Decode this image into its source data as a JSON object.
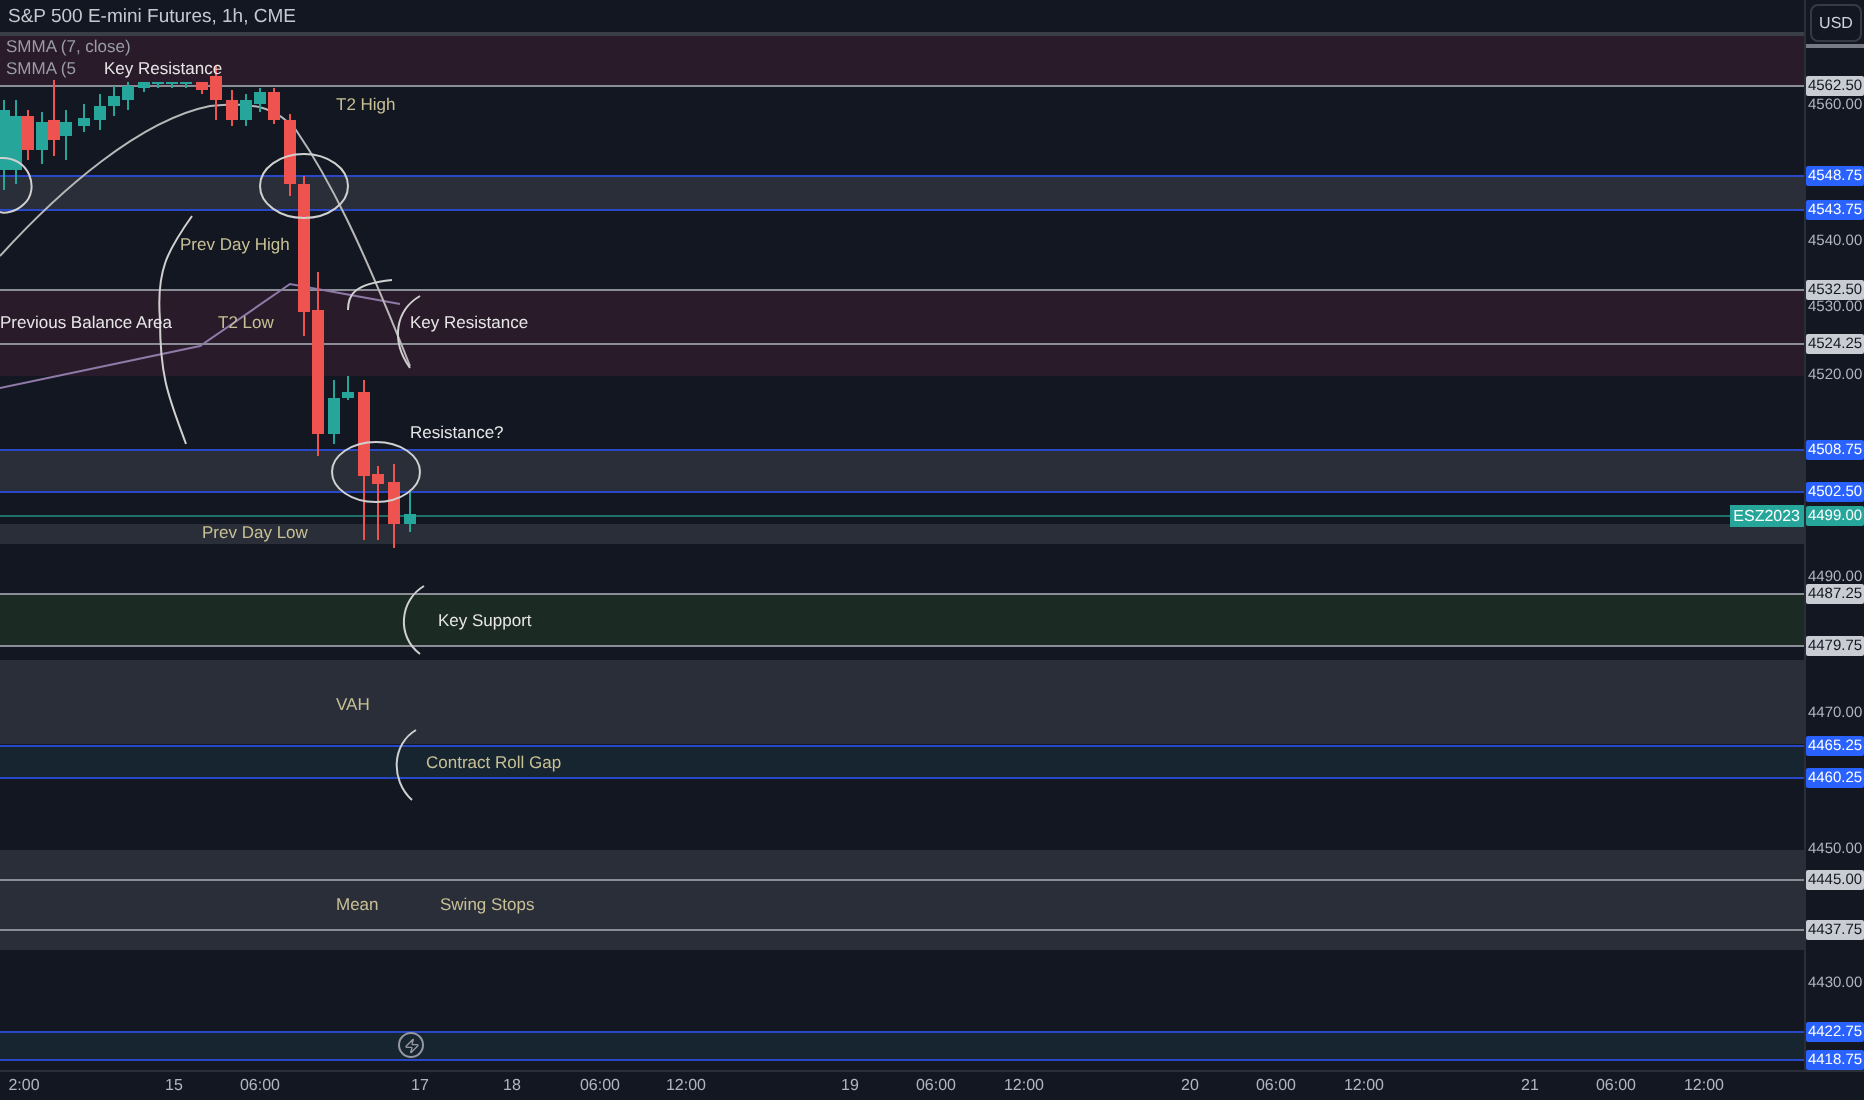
{
  "header": {
    "title": "S&P 500 E-mini Futures, 1h, CME",
    "indicators": [
      "SMMA (7, close)",
      "SMMA (5"
    ]
  },
  "currency_button": "USD",
  "annotations": [
    {
      "text": "Key Resistance",
      "kind": "note"
    },
    {
      "text": "T2 High",
      "kind": "level"
    },
    {
      "text": "Prev Day High",
      "kind": "level"
    },
    {
      "text": "Previous Balance Area",
      "kind": "note"
    },
    {
      "text": "T2 Low",
      "kind": "level"
    },
    {
      "text": "Key Resistance",
      "kind": "note"
    },
    {
      "text": "Resistance?",
      "kind": "note"
    },
    {
      "text": "Prev Day Low",
      "kind": "level"
    },
    {
      "text": "Key Support",
      "kind": "note"
    },
    {
      "text": "VAH",
      "kind": "level"
    },
    {
      "text": "Contract Roll Gap",
      "kind": "level"
    },
    {
      "text": "Mean",
      "kind": "level"
    },
    {
      "text": "Swing Stops",
      "kind": "level"
    }
  ],
  "price_ticks": [
    "4560.00",
    "4540.00",
    "4530.00",
    "4520.00",
    "4490.00",
    "4470.00",
    "4450.00",
    "4430.00"
  ],
  "price_tags": [
    {
      "text": "4562.50",
      "kind": "grey"
    },
    {
      "text": "4548.75",
      "kind": "blue"
    },
    {
      "text": "4543.75",
      "kind": "blue"
    },
    {
      "text": "4532.50",
      "kind": "grey"
    },
    {
      "text": "4524.25",
      "kind": "grey"
    },
    {
      "text": "4508.75",
      "kind": "blue"
    },
    {
      "text": "4502.50",
      "kind": "blue"
    },
    {
      "text": "4499.00",
      "kind": "last",
      "symbol": "ESZ2023"
    },
    {
      "text": "4487.25",
      "kind": "grey"
    },
    {
      "text": "4479.75",
      "kind": "grey"
    },
    {
      "text": "4465.25",
      "kind": "blue"
    },
    {
      "text": "4460.25",
      "kind": "blue"
    },
    {
      "text": "4445.00",
      "kind": "grey"
    },
    {
      "text": "4437.75",
      "kind": "grey"
    },
    {
      "text": "4422.75",
      "kind": "blue"
    },
    {
      "text": "4418.75",
      "kind": "blue"
    }
  ],
  "time_ticks": [
    "2:00",
    "15",
    "06:00",
    "17",
    "18",
    "06:00",
    "12:00",
    "19",
    "06:00",
    "12:00",
    "20",
    "06:00",
    "12:00",
    "21",
    "06:00",
    "12:00"
  ]
}
